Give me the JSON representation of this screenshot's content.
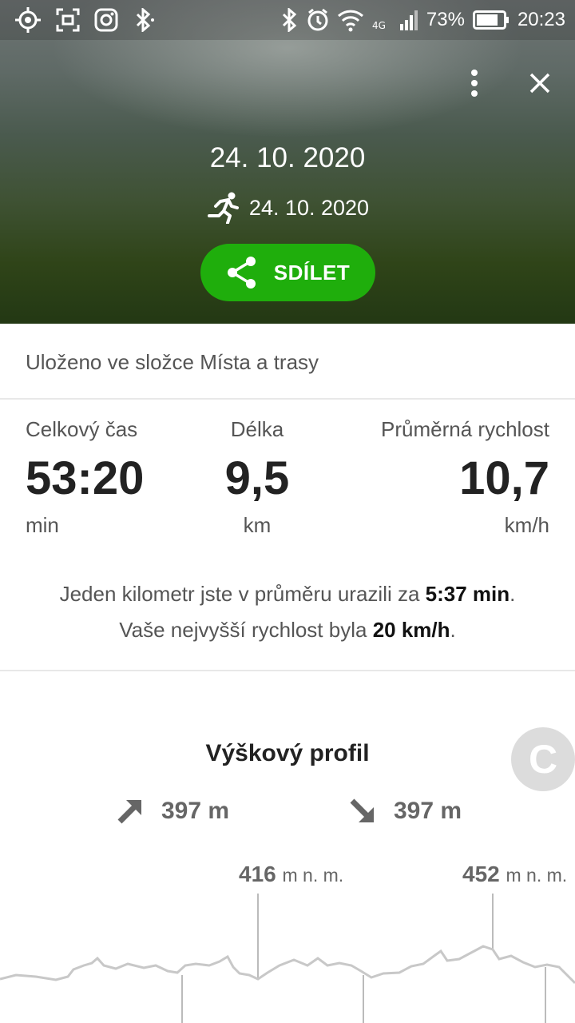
{
  "status_bar": {
    "left_icons": [
      "location-icon",
      "screenshot-icon",
      "instagram-icon",
      "bluetooth-audio-icon"
    ],
    "right_icons": [
      "bluetooth-icon",
      "alarm-icon",
      "wifi-icon",
      "network-4g-icon",
      "signal-icon",
      "battery-icon"
    ],
    "battery": "73%",
    "time": "20:23"
  },
  "header": {
    "title_date": "24. 10. 2020",
    "activity_date": "24. 10. 2020",
    "activity_icon": "running-icon",
    "share_label": "SDÍLET",
    "menu_icon": "more-vert-icon",
    "close_icon": "close-icon"
  },
  "saved_text": "Uloženo ve složce Místa a trasy",
  "stats": {
    "total_time": {
      "label": "Celkový čas",
      "value": "53:20",
      "unit": "min"
    },
    "length": {
      "label": "Délka",
      "value": "9,5",
      "unit": "km"
    },
    "avg_speed": {
      "label": "Průměrná rychlost",
      "value": "10,7",
      "unit": "km/h"
    }
  },
  "summary": {
    "line1_prefix": "Jeden kilometr jste v průměru urazili za",
    "line1_value": "5:37 min",
    "line1_suffix": ".",
    "line2_prefix": "Vaše nejvyšší rychlost byla",
    "line2_value": "20 km/h",
    "line2_suffix": "."
  },
  "elevation": {
    "title": "Výškový profil",
    "ascent": "397 m",
    "descent": "397 m",
    "peaks": [
      {
        "value": "416",
        "unit": "m n. m."
      },
      {
        "value": "452",
        "unit": "m n. m."
      }
    ],
    "fab_label": "C"
  },
  "colors": {
    "accent_green": "#1fae0c",
    "text_dark": "#222222",
    "text_muted": "#555555"
  }
}
